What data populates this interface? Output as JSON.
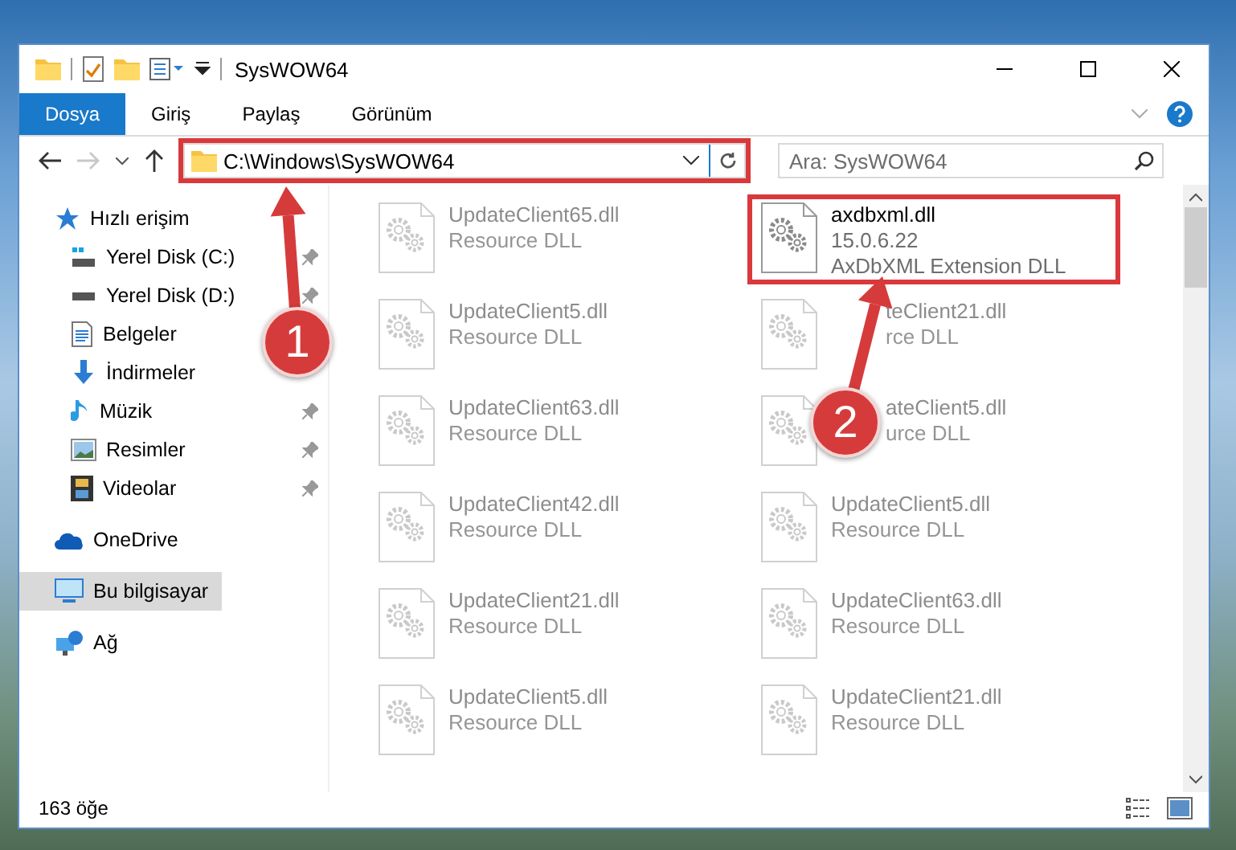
{
  "window": {
    "title": "SysWOW64"
  },
  "ribbon": {
    "tabs": [
      {
        "label": "Dosya",
        "selected": true
      },
      {
        "label": "Giriş",
        "selected": false
      },
      {
        "label": "Paylaş",
        "selected": false
      },
      {
        "label": "Görünüm",
        "selected": false
      }
    ]
  },
  "address_bar": {
    "path": "C:\\Windows\\SysWOW64",
    "highlighted": true,
    "forward_disabled": true
  },
  "search": {
    "placeholder": "Ara: SysWOW64"
  },
  "sidebar": {
    "items": [
      {
        "label": "Hızlı erişim",
        "selected": false,
        "children": [
          {
            "label": "Yerel Disk (C:)",
            "pinned": true,
            "selected": false
          },
          {
            "label": "Yerel Disk (D:)",
            "pinned": true,
            "selected": false
          },
          {
            "label": "Belgeler",
            "pinned": false,
            "selected": false
          },
          {
            "label": "İndirmeler",
            "pinned": false,
            "selected": false
          },
          {
            "label": "Müzik",
            "pinned": true,
            "selected": false
          },
          {
            "label": "Resimler",
            "pinned": true,
            "selected": false
          },
          {
            "label": "Videolar",
            "pinned": true,
            "selected": false
          }
        ]
      },
      {
        "label": "OneDrive",
        "selected": false
      },
      {
        "label": "Bu bilgisayar",
        "selected": true
      },
      {
        "label": "Ağ",
        "selected": false
      }
    ]
  },
  "files": [
    {
      "name": "UpdateClient65.dll",
      "lines": [
        "Resource DLL"
      ],
      "faded": true,
      "highlighted": false
    },
    {
      "name": "axdbxml.dll",
      "lines": [
        "15.0.6.22",
        "AxDbXML Extension DLL"
      ],
      "faded": false,
      "highlighted": true
    },
    {
      "name": "UpdateClient5.dll",
      "lines": [
        "Resource DLL"
      ],
      "faded": true,
      "highlighted": false
    },
    {
      "name": "teClient21.dll",
      "lines": [
        "rce DLL"
      ],
      "faded": true,
      "highlighted": false,
      "partly_covered": true
    },
    {
      "name": "UpdateClient63.dll",
      "lines": [
        "Resource DLL"
      ],
      "faded": true,
      "highlighted": false
    },
    {
      "name": "ateClient5.dll",
      "lines": [
        "urce DLL"
      ],
      "faded": true,
      "highlighted": false,
      "partly_covered": true
    },
    {
      "name": "UpdateClient42.dll",
      "lines": [
        "Resource DLL"
      ],
      "faded": true,
      "highlighted": false
    },
    {
      "name": "UpdateClient5.dll",
      "lines": [
        "Resource DLL"
      ],
      "faded": true,
      "highlighted": false
    },
    {
      "name": "UpdateClient21.dll",
      "lines": [
        "Resource DLL"
      ],
      "faded": true,
      "highlighted": false
    },
    {
      "name": "UpdateClient63.dll",
      "lines": [
        "Resource DLL"
      ],
      "faded": true,
      "highlighted": false
    },
    {
      "name": "UpdateClient5.dll",
      "lines": [
        "Resource DLL"
      ],
      "faded": true,
      "highlighted": false
    },
    {
      "name": "UpdateClient21.dll",
      "lines": [
        "Resource DLL"
      ],
      "faded": true,
      "highlighted": false
    }
  ],
  "callouts": [
    {
      "number": "1"
    },
    {
      "number": "2"
    }
  ],
  "status_bar": {
    "item_count": "163 öğe"
  }
}
